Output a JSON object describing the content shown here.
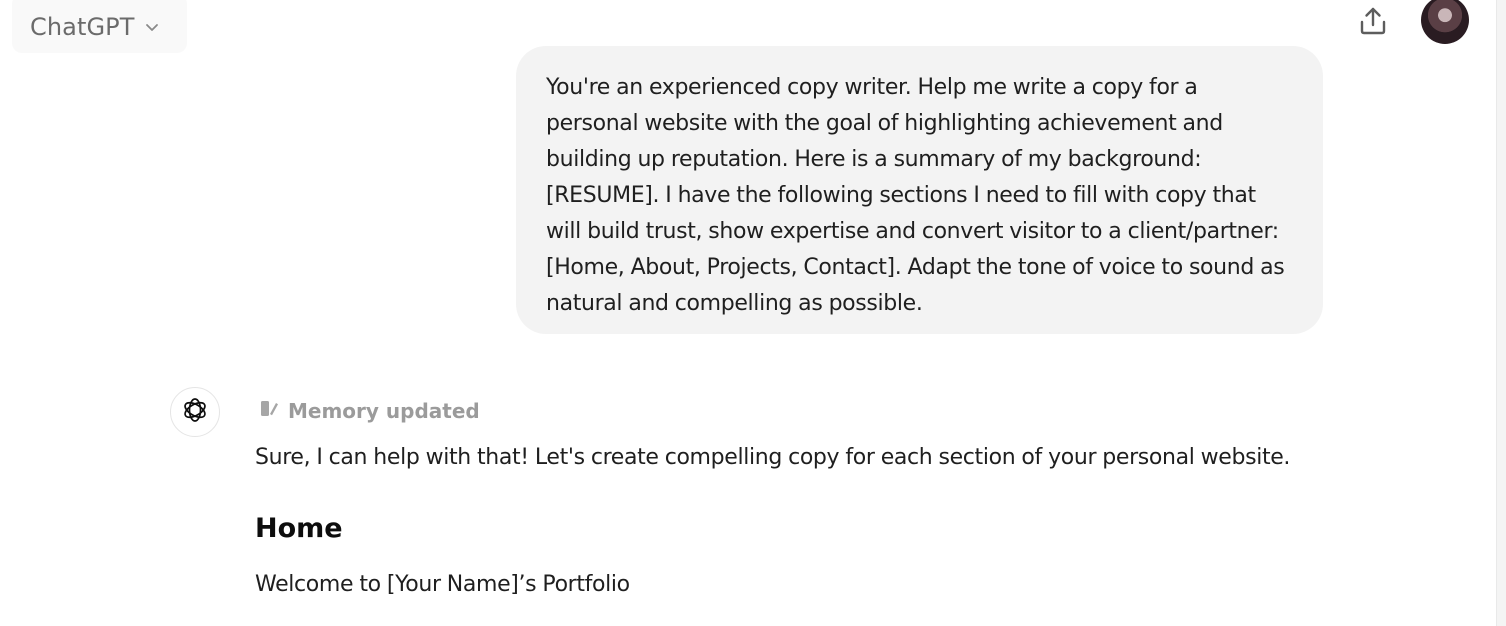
{
  "header": {
    "model_name": "ChatGPT",
    "model_menu_icon": "chevron-down-icon",
    "share_icon": "share-upload-icon",
    "avatar": "user-avatar"
  },
  "conversation": {
    "user_message": "You're an experienced copy writer. Help me write a copy for a personal website with the goal of highlighting achievement and building up reputation. Here is a summary of my background: [RESUME]. I have the following sections I need to fill with copy that will build trust, show expertise and convert visitor to a client/partner: [Home, About, Projects, Contact]. Adapt the tone of voice to sound as natural and compelling as possible.",
    "assistant": {
      "avatar_icon": "openai-logo-icon",
      "memory_icon": "memory-edit-icon",
      "memory_label": "Memory updated",
      "intro": "Sure, I can help with that! Let's create compelling copy for each section of your personal website.",
      "section_heading": "Home",
      "section_line": "Welcome to [Your Name]’s Portfolio"
    }
  },
  "colors": {
    "bubble_bg": "#f3f3f3",
    "muted_text": "#9b9b9b",
    "header_button_bg": "#f9f9f9"
  }
}
